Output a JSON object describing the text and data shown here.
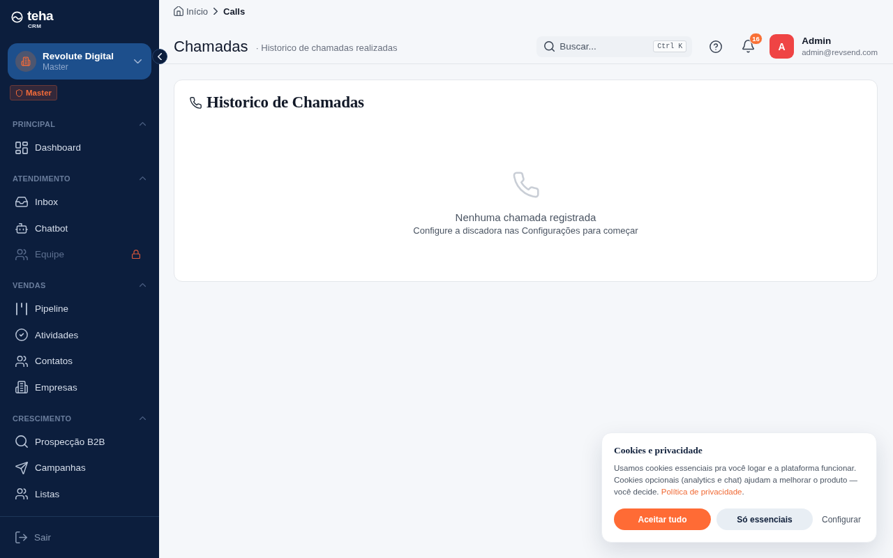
{
  "sidebar": {
    "logo": {
      "name": "teha",
      "tag": "CRM"
    },
    "workspace": {
      "name": "Revolute Digital",
      "role": "Master"
    },
    "role_badge": "Master",
    "sections": [
      {
        "title": "PRINCIPAL",
        "expanded": true,
        "items": [
          {
            "label": "Dashboard",
            "selected": false,
            "locked": false
          }
        ]
      },
      {
        "title": "ATENDIMENTO",
        "expanded": true,
        "items": [
          {
            "label": "Inbox",
            "selected": false,
            "locked": false
          },
          {
            "label": "Chatbot",
            "selected": false,
            "locked": false
          },
          {
            "label": "Equipe",
            "selected": false,
            "locked": true
          }
        ]
      },
      {
        "title": "VENDAS",
        "expanded": true,
        "items": [
          {
            "label": "Pipeline",
            "selected": false,
            "locked": false
          },
          {
            "label": "Atividades",
            "selected": false,
            "locked": false
          },
          {
            "label": "Contatos",
            "selected": false,
            "locked": false
          },
          {
            "label": "Empresas",
            "selected": false,
            "locked": false
          }
        ]
      },
      {
        "title": "CRESCIMENTO",
        "expanded": true,
        "items": [
          {
            "label": "Prospecção B2B",
            "selected": false,
            "locked": false
          },
          {
            "label": "Campanhas",
            "selected": false,
            "locked": false
          },
          {
            "label": "Listas",
            "selected": false,
            "locked": false
          }
        ]
      }
    ],
    "footer": {
      "label": "Sair"
    }
  },
  "header": {
    "breadcrumb": [
      {
        "label": "Início",
        "current": false
      },
      {
        "label": "Calls",
        "current": true
      }
    ],
    "title": "Chamadas",
    "subtitle": "· Historico de chamadas realizadas",
    "search": {
      "placeholder": "Buscar...",
      "shortcut": "Ctrl K"
    },
    "notifications": {
      "count": "16"
    },
    "user": {
      "initial": "A",
      "name": "Admin",
      "email": "admin@revsend.com"
    }
  },
  "card": {
    "title": "Historico de Chamadas",
    "empty_state": {
      "title": "Nenhuma chamada registrada",
      "hint": "Configure a discadora nas Configurações para começar"
    }
  },
  "cookie_banner": {
    "title": "Cookies e privacidade",
    "text": "Usamos cookies essenciais pra você logar e a plataforma funcionar. Cookies opcionais (analytics e chat) ajudam a melhorar o produto — você decide.",
    "link": "Política de privacidade",
    "text_end": ".",
    "buttons": [
      {
        "label": "Aceitar tudo",
        "kind": "primary"
      },
      {
        "label": "Só essenciais",
        "kind": "secondary"
      },
      {
        "label": "Configurar",
        "kind": "link"
      }
    ]
  }
}
